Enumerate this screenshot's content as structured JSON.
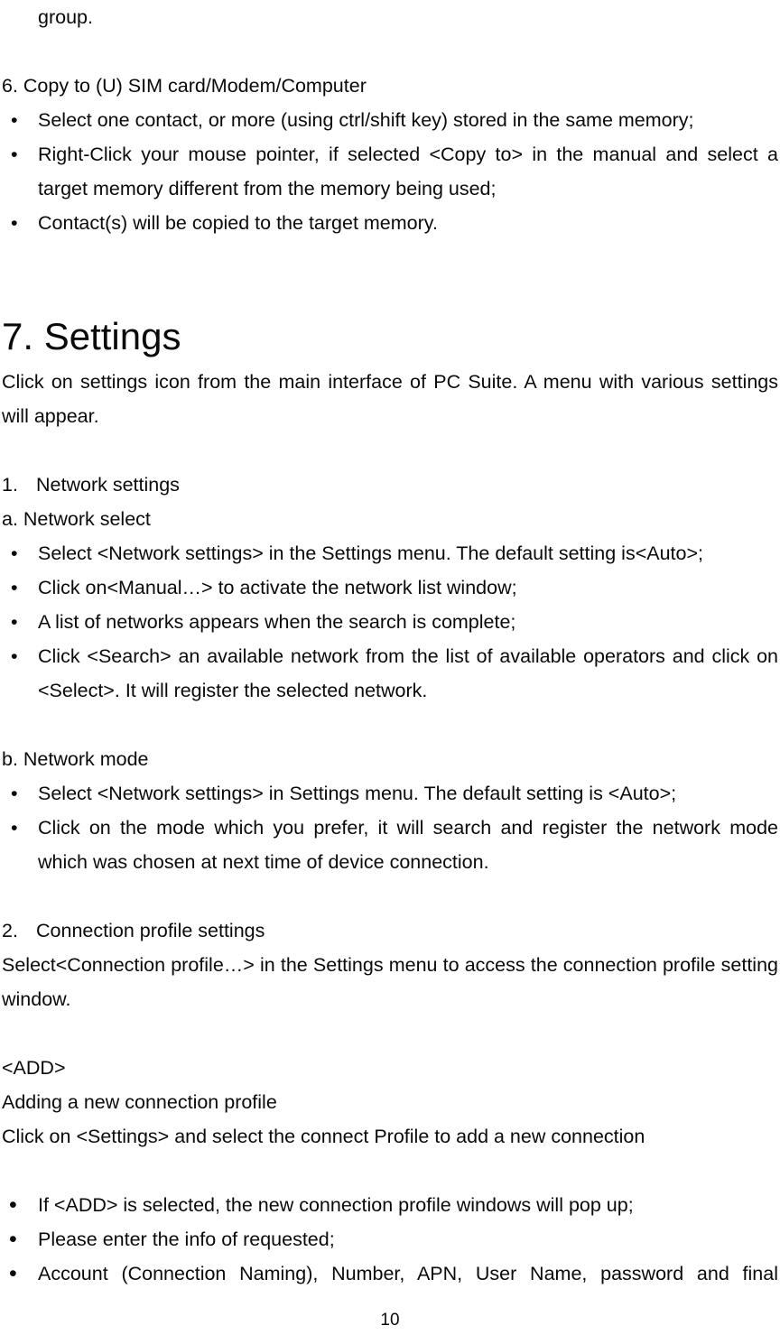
{
  "page": {
    "number": "10",
    "bullet_glyph": "•"
  },
  "continuation": {
    "text": "group."
  },
  "section6": {
    "heading": "6. Copy to (U) SIM card/Modem/Computer",
    "bullets": [
      "Select one contact, or more (using ctrl/shift key) stored in the same memory;",
      "Right-Click your mouse pointer, if selected <Copy to> in the manual and select a target memory different from the memory being used;",
      "Contact(s) will be copied to the target memory."
    ]
  },
  "chapter7": {
    "title": "7. Settings",
    "intro": "Click on settings icon from the main interface of PC Suite. A menu with various settings will appear."
  },
  "item1": {
    "number": "1.",
    "label": "Network settings",
    "sub_a": {
      "label": "a. Network select",
      "bullets": [
        "Select <Network settings> in the Settings menu. The default setting is<Auto>;",
        "Click on<Manual…> to activate the network list window;",
        "A list of networks appears when the search is complete;",
        "Click <Search> an available network from the list of available operators and click on <Select>. It will register the selected network."
      ]
    },
    "sub_b": {
      "label": "b. Network mode",
      "bullets": [
        "Select <Network settings> in Settings menu. The default setting is <Auto>;",
        "Click on the mode which you prefer, it will search and register the network mode which was chosen at next time of device connection."
      ]
    }
  },
  "item2": {
    "number": "2.",
    "label": "Connection profile settings",
    "intro": "Select<Connection profile…> in the Settings menu to access the connection profile setting window.",
    "add_block": {
      "title": "<ADD>",
      "line1": "Adding a new connection profile",
      "line2": "Click on <Settings> and select the connect Profile to add a new connection"
    },
    "bullets": [
      "If <ADD> is selected, the new connection profile windows will pop up;",
      "Please enter the info of requested;",
      "Account (Connection Naming), Number, APN, User Name, password and final"
    ]
  }
}
